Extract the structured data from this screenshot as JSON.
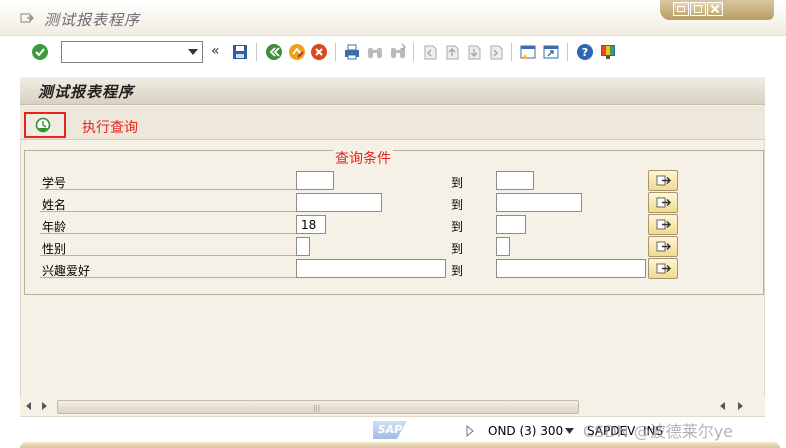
{
  "window": {
    "title": "测试报表程序"
  },
  "toolbar": {
    "command_value": "",
    "icons": [
      "enter-icon",
      "back-icon",
      "exit-icon",
      "cancel-icon",
      "save-icon",
      "print-icon",
      "find-icon",
      "find-next-icon",
      "first-page-icon",
      "previous-page-icon",
      "next-page-icon",
      "last-page-icon",
      "create-session-icon",
      "shortcut-icon",
      "help-icon",
      "layout-icon"
    ]
  },
  "page": {
    "title": "测试报表程序"
  },
  "appbar": {
    "execute_label": "执行查询"
  },
  "frame": {
    "title": "查询条件",
    "to_label": "到",
    "rows": [
      {
        "label": "学号",
        "low": "",
        "high": ""
      },
      {
        "label": "姓名",
        "low": "",
        "high": ""
      },
      {
        "label": "年龄",
        "low": "18",
        "high": ""
      },
      {
        "label": "性别",
        "low": "",
        "high": ""
      },
      {
        "label": "兴趣爱好",
        "low": "",
        "high": ""
      }
    ]
  },
  "statusbar": {
    "logo": "SAP",
    "system": "OND (3) 300",
    "server": "SAPDEV",
    "mode": "INS",
    "watermark": "CSDN @波德莱尔ye"
  },
  "colors": {
    "highlight": "#e8231b",
    "frame_bg": "#f6f1e6",
    "accent_gold": "#c2a872"
  }
}
